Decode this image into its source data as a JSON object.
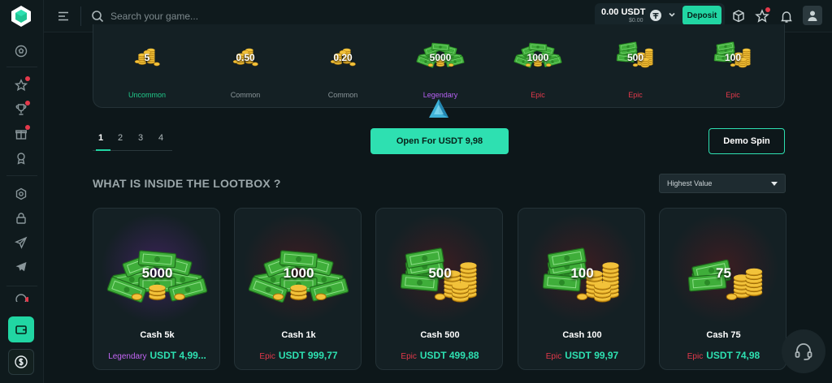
{
  "topbar": {
    "search_placeholder": "Search your game...",
    "balance_amount": "0.00 USDT",
    "balance_fiat": "$0.00",
    "deposit_label": "Deposit"
  },
  "reel": {
    "items": [
      {
        "value": "5",
        "rarity": "Uncommon",
        "color": "#21c98a"
      },
      {
        "value": "0.50",
        "rarity": "Common",
        "color": "#8a9599"
      },
      {
        "value": "0.20",
        "rarity": "Common",
        "color": "#8a9599"
      },
      {
        "value": "5000",
        "rarity": "Legendary",
        "color": "#b560f2"
      },
      {
        "value": "1000",
        "rarity": "Epic",
        "color": "#e5394b"
      },
      {
        "value": "500",
        "rarity": "Epic",
        "color": "#e5394b"
      },
      {
        "value": "100",
        "rarity": "Epic",
        "color": "#e5394b"
      }
    ]
  },
  "pager": {
    "pages": [
      "1",
      "2",
      "3",
      "4"
    ],
    "active_page": 1
  },
  "actions": {
    "open_label": "Open For USDT 9,98",
    "demo_label": "Demo Spin"
  },
  "section": {
    "title": "WHAT IS INSIDE THE LOOTBOX ?",
    "sort_value": "Highest Value"
  },
  "cards": [
    {
      "value": "5000",
      "name": "Cash 5k",
      "rarity": "Legendary",
      "price": "USDT 4,99...",
      "rarity_color": "#c466f5",
      "glow": "#3b2358"
    },
    {
      "value": "1000",
      "name": "Cash 1k",
      "rarity": "Epic",
      "price": "USDT 999,77",
      "rarity_color": "#e5394b",
      "glow": "#3c1d22"
    },
    {
      "value": "500",
      "name": "Cash 500",
      "rarity": "Epic",
      "price": "USDT 499,88",
      "rarity_color": "#e5394b",
      "glow": "#3c1d22"
    },
    {
      "value": "100",
      "name": "Cash 100",
      "rarity": "Epic",
      "price": "USDT 99,97",
      "rarity_color": "#e5394b",
      "glow": "#3c1d22"
    },
    {
      "value": "75",
      "name": "Cash 75",
      "rarity": "Epic",
      "price": "USDT 74,98",
      "rarity_color": "#e5394b",
      "glow": "#3c1d22"
    }
  ],
  "colors": {
    "accent": "#21d6a3",
    "background": "#0d171a",
    "notification": "#e5394b"
  }
}
